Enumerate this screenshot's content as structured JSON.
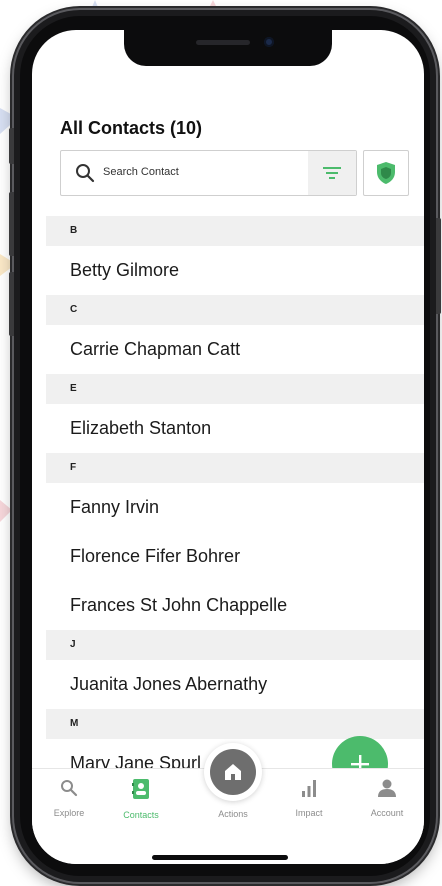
{
  "header": {
    "title": "All Contacts (10)"
  },
  "search": {
    "placeholder": "Search Contact"
  },
  "icons": {
    "search": "search-icon",
    "filter": "filter-icon",
    "shield": "shield-icon",
    "add": "plus-icon",
    "home": "home-icon"
  },
  "colors": {
    "accent": "#4cbb6c",
    "section_bg": "#f0f0f0",
    "tab_inactive": "#8c8c8c"
  },
  "sections": [
    {
      "letter": "B",
      "contacts": [
        "Betty Gilmore"
      ]
    },
    {
      "letter": "C",
      "contacts": [
        "Carrie Chapman Catt"
      ]
    },
    {
      "letter": "E",
      "contacts": [
        "Elizabeth Stanton"
      ]
    },
    {
      "letter": "F",
      "contacts": [
        "Fanny Irvin",
        "Florence Fifer Bohrer",
        "Frances St John Chappelle"
      ]
    },
    {
      "letter": "J",
      "contacts": [
        "Juanita Jones Abernathy"
      ]
    },
    {
      "letter": "M",
      "contacts": [
        "Mary Jane Spurl"
      ]
    }
  ],
  "tabs": [
    {
      "label": "Explore",
      "icon": "search-icon",
      "active": false
    },
    {
      "label": "Contacts",
      "icon": "contacts-icon",
      "active": true
    },
    {
      "label": "Actions",
      "icon": "home-icon",
      "active": false
    },
    {
      "label": "Impact",
      "icon": "bar-chart-icon",
      "active": false
    },
    {
      "label": "Account",
      "icon": "person-icon",
      "active": false
    }
  ]
}
